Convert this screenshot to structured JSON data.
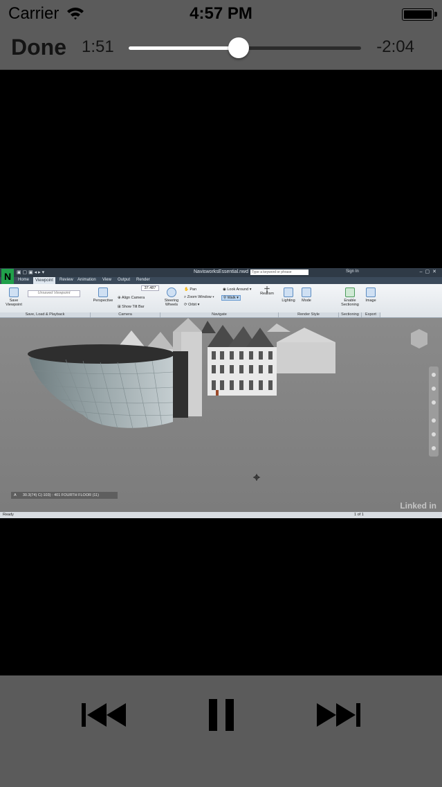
{
  "status_bar": {
    "carrier": "Carrier",
    "time": "4:57 PM",
    "battery_level": 1.0
  },
  "player": {
    "done_label": "Done",
    "elapsed": "1:51",
    "remaining": "-2:04",
    "progress": 0.473
  },
  "video": {
    "app_title": "NavisworksEssential.nwd",
    "logo_letter": "N",
    "search_placeholder": "Type a keyword or phrase",
    "sign_in": "Sign In",
    "tabs": [
      "Home",
      "Viewpoint",
      "Review",
      "Animation",
      "View",
      "Output",
      "Render"
    ],
    "active_tab": "Viewpoint",
    "ribbon_buttons": {
      "save_viewpoint": "Save Viewpoint",
      "saved_viewpoint_combo": "Unsaved Viewpoint",
      "perspective": "Perspective",
      "align_camera": "Align Camera",
      "show_tilt_bar": "Show Tilt Bar",
      "field_value": "37.487",
      "steering_wheels": "Steering Wheels",
      "pan": "Pan",
      "zoom_window": "Zoom Window",
      "orbit": "Orbit",
      "look_around": "Look Around",
      "walk": "Walk",
      "realism": "Realism",
      "lighting": "Lighting",
      "mode": "Mode",
      "enable_sectioning": "Enable Sectioning",
      "image": "Image"
    },
    "groups": [
      "Save, Load & Playback",
      "Camera",
      "Navigate",
      "Render Style",
      "Sectioning",
      "Export"
    ],
    "coord_readout": "30.3(74) C(-103) : 401 FOURTH FLOOR (11)",
    "coord_prefix": "A",
    "status_text": "Ready",
    "page_indicator": "1 of 1",
    "watermark": "Linked in"
  },
  "controls": {
    "previous_icon": "skip-back-icon",
    "pause_icon": "pause-icon",
    "next_icon": "skip-forward-icon"
  },
  "colors": {
    "bar_bg": "#5b5b5b",
    "accent_green": "#20a04a"
  }
}
